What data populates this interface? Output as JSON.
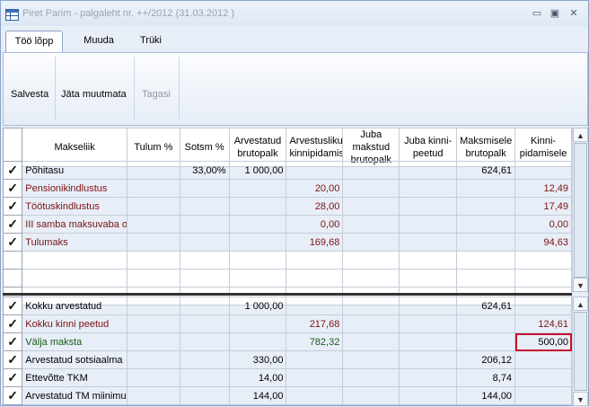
{
  "window": {
    "title": "Piret Parim - palgaleht nr. ++/2012 (31.03.2012 )",
    "min_icon": "minimize-icon",
    "restore_icon": "restore-icon",
    "close_icon": "close-icon"
  },
  "tabs": [
    {
      "label": "Töö lõpp",
      "active": true
    },
    {
      "label": "Muuda",
      "active": false
    },
    {
      "label": "Trüki",
      "active": false
    }
  ],
  "ribbon": {
    "save": "Salvesta",
    "discard": "Jäta muutmata",
    "back": "Tagasi"
  },
  "columns": [
    "Makseliik",
    "Tulum %",
    "Sotsm %",
    "Arvestatud brutopalk",
    "Arvestusliku kinnipidamise",
    "Juba makstud brutopalk",
    "Juba kinni-peetud",
    "Maksmisele brutopalk",
    "Kinni-pidamisele"
  ],
  "top_rows": [
    {
      "name": "Põhitasu",
      "tulum": "",
      "sotsm": "33,00%",
      "arvbruto": "1 000,00",
      "arvkinni": "",
      "jubabruto": "",
      "jubakinni": "",
      "maksbruto": "624,61",
      "kinnipid": "",
      "style": "normal",
      "checked": true
    },
    {
      "name": "Pensionikindlustus",
      "tulum": "",
      "sotsm": "",
      "arvbruto": "",
      "arvkinni": "20,00",
      "jubabruto": "",
      "jubakinni": "",
      "maksbruto": "",
      "kinnipid": "12,49",
      "style": "maroon",
      "checked": true
    },
    {
      "name": "Töötuskindlustus",
      "tulum": "",
      "sotsm": "",
      "arvbruto": "",
      "arvkinni": "28,00",
      "jubabruto": "",
      "jubakinni": "",
      "maksbruto": "",
      "kinnipid": "17,49",
      "style": "maroon",
      "checked": true
    },
    {
      "name": "III samba maksuvaba o",
      "tulum": "",
      "sotsm": "",
      "arvbruto": "",
      "arvkinni": "0,00",
      "jubabruto": "",
      "jubakinni": "",
      "maksbruto": "",
      "kinnipid": "0,00",
      "style": "maroon",
      "checked": true
    },
    {
      "name": "Tulumaks",
      "tulum": "",
      "sotsm": "",
      "arvbruto": "",
      "arvkinni": "169,68",
      "jubabruto": "",
      "jubakinni": "",
      "maksbruto": "",
      "kinnipid": "94,63",
      "style": "maroon",
      "checked": true
    }
  ],
  "bottom_rows": [
    {
      "name": "Kokku arvestatud",
      "tulum": "",
      "sotsm": "",
      "arvbruto": "1 000,00",
      "arvkinni": "",
      "jubabruto": "",
      "jubakinni": "",
      "maksbruto": "624,61",
      "kinnipid": "",
      "style": "normal",
      "checked": true
    },
    {
      "name": "Kokku kinni peetud",
      "tulum": "",
      "sotsm": "",
      "arvbruto": "",
      "arvkinni": "217,68",
      "jubabruto": "",
      "jubakinni": "",
      "maksbruto": "",
      "kinnipid": "124,61",
      "style": "maroon",
      "checked": true
    },
    {
      "name": "Välja maksta",
      "tulum": "",
      "sotsm": "",
      "arvbruto": "",
      "arvkinni": "782,32",
      "jubabruto": "",
      "jubakinni": "",
      "maksbruto": "",
      "kinnipid": "500,00",
      "style": "green",
      "checked": true,
      "highlight": true
    },
    {
      "name": "Arvestatud sotsiaalma",
      "tulum": "",
      "sotsm": "",
      "arvbruto": "330,00",
      "arvkinni": "",
      "jubabruto": "",
      "jubakinni": "",
      "maksbruto": "206,12",
      "kinnipid": "",
      "style": "normal",
      "checked": true
    },
    {
      "name": "Ettevõtte TKM",
      "tulum": "",
      "sotsm": "",
      "arvbruto": "14,00",
      "arvkinni": "",
      "jubabruto": "",
      "jubakinni": "",
      "maksbruto": "8,74",
      "kinnipid": "",
      "style": "normal",
      "checked": true
    },
    {
      "name": "Arvestatud TM miinimu",
      "tulum": "",
      "sotsm": "",
      "arvbruto": "144,00",
      "arvkinni": "",
      "jubabruto": "",
      "jubakinni": "",
      "maksbruto": "144,00",
      "kinnipid": "",
      "style": "normal",
      "checked": true
    }
  ],
  "icons": {
    "check": "checkmark-icon",
    "scroll_up": "scroll-up-arrow-icon",
    "scroll_down": "scroll-down-arrow-icon",
    "app": "spreadsheet-icon"
  },
  "colors": {
    "maroon": "#7a1212",
    "green": "#165b16",
    "highlight": "#c8102e"
  }
}
